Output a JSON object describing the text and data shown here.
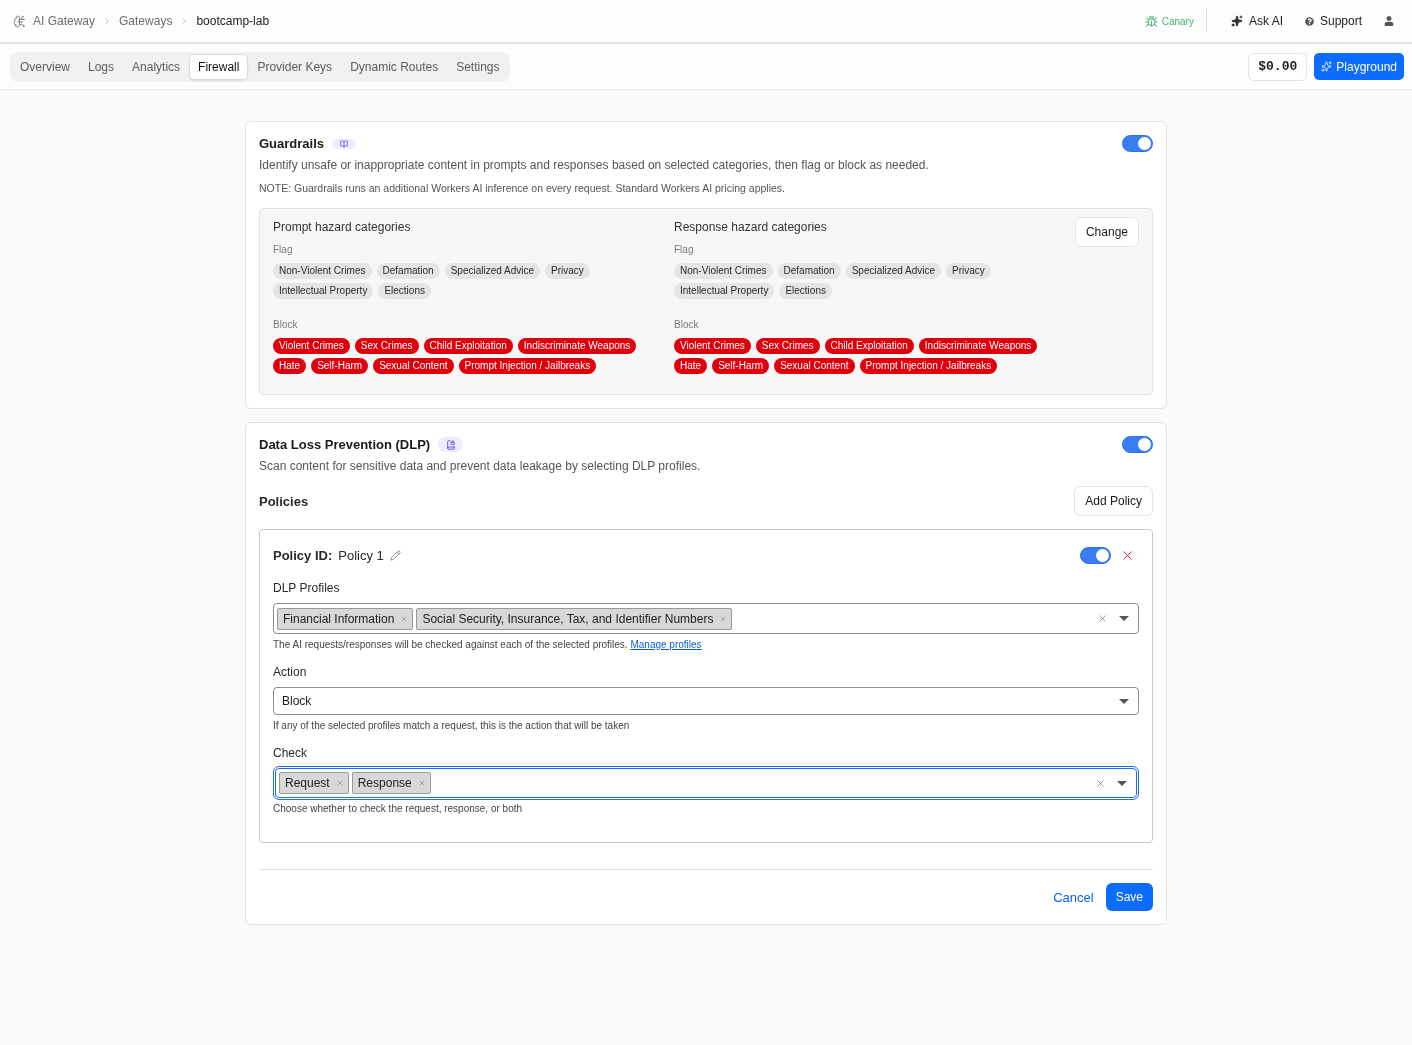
{
  "breadcrumbs": [
    {
      "label": "AI Gateway",
      "current": false
    },
    {
      "label": "Gateways",
      "current": false
    },
    {
      "label": "bootcamp-lab",
      "current": true
    }
  ],
  "header_actions": {
    "canary": "Canary",
    "ask_ai": "Ask AI",
    "support": "Support"
  },
  "tabs": [
    {
      "label": "Overview",
      "selected": false
    },
    {
      "label": "Logs",
      "selected": false
    },
    {
      "label": "Analytics",
      "selected": false
    },
    {
      "label": "Firewall",
      "selected": true
    },
    {
      "label": "Provider Keys",
      "selected": false
    },
    {
      "label": "Dynamic Routes",
      "selected": false
    },
    {
      "label": "Settings",
      "selected": false
    }
  ],
  "cost": "$0.00",
  "playground_button": "Playground",
  "guardrails": {
    "title": "Guardrails",
    "on": true,
    "description": "Identify unsafe or inappropriate content in prompts and responses based on selected categories, then flag or block as needed.",
    "note": "NOTE: Guardrails runs an additional Workers AI inference on every request. Standard Workers AI pricing applies.",
    "columns": [
      {
        "title": "Prompt hazard categories",
        "groups": [
          {
            "kind": "flag",
            "label": "Flag",
            "tags": [
              "Non-Violent Crimes",
              "Defamation",
              "Specialized Advice",
              "Privacy",
              "Intellectual Property",
              "Elections"
            ]
          },
          {
            "kind": "block",
            "label": "Block",
            "tags": [
              "Violent Crimes",
              "Sex Crimes",
              "Child Exploitation",
              "Indiscriminate Weapons",
              "Hate",
              "Self-Harm",
              "Sexual Content",
              "Prompt Injection / Jailbreaks"
            ]
          }
        ]
      },
      {
        "title": "Response hazard categories",
        "groups": [
          {
            "kind": "flag",
            "label": "Flag",
            "tags": [
              "Non-Violent Crimes",
              "Defamation",
              "Specialized Advice",
              "Privacy",
              "Intellectual Property",
              "Elections"
            ]
          },
          {
            "kind": "block",
            "label": "Block",
            "tags": [
              "Violent Crimes",
              "Sex Crimes",
              "Child Exploitation",
              "Indiscriminate Weapons",
              "Hate",
              "Self-Harm",
              "Sexual Content",
              "Prompt Injection / Jailbreaks"
            ]
          }
        ]
      }
    ],
    "change_button": "Change"
  },
  "dlp": {
    "title": "Data Loss Prevention (DLP)",
    "on": true,
    "description": "Scan content for sensitive data and prevent data leakage by selecting DLP profiles.",
    "policies_title": "Policies",
    "add_policy_button": "Add Policy",
    "policies": [
      {
        "id_label": "Policy ID:",
        "name": "Policy 1",
        "on": true,
        "fields": [
          {
            "kind": "multi",
            "label": "DLP Profiles",
            "values": [
              "Financial Information",
              "Social Security, Insurance, Tax, and Identifier Numbers"
            ],
            "focused": false,
            "help": "The AI requests/responses will be checked against each of the selected profiles.",
            "link": "Manage profiles"
          },
          {
            "kind": "select",
            "label": "Action",
            "value": "Block",
            "focused": false,
            "help": "If any of the selected profiles match a request, this is the action that will be taken"
          },
          {
            "kind": "multi",
            "label": "Check",
            "values": [
              "Request",
              "Response"
            ],
            "focused": true,
            "help": "Choose whether to check the request, response, or both"
          }
        ]
      }
    ],
    "cancel_button": "Cancel",
    "save_button": "Save"
  }
}
